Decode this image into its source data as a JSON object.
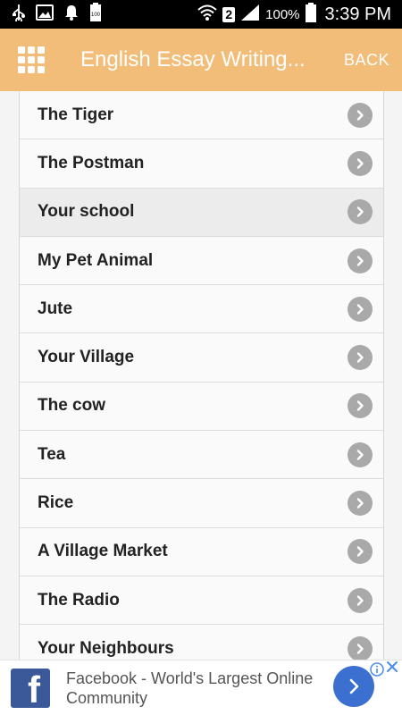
{
  "status_bar": {
    "sim_slot": "2",
    "battery_level": "100%",
    "battery_badge": "100",
    "time": "3:39 PM",
    "icons": [
      "usb-icon",
      "image-icon",
      "notification-bell-icon",
      "battery-full-icon",
      "wifi-icon",
      "signal-icon",
      "battery-icon"
    ]
  },
  "app_bar": {
    "menu_icon": "grid-menu-icon",
    "title": "English Essay Writing...",
    "back_label": "BACK",
    "color": "#f2bd78"
  },
  "list": {
    "items": [
      {
        "label": "The Tiger"
      },
      {
        "label": "The Postman"
      },
      {
        "label": "Your school",
        "selected": true
      },
      {
        "label": "My Pet Animal"
      },
      {
        "label": "Jute"
      },
      {
        "label": "Your Village"
      },
      {
        "label": "The cow"
      },
      {
        "label": "Tea"
      },
      {
        "label": "Rice"
      },
      {
        "label": "A Village Market"
      },
      {
        "label": "The Radio"
      },
      {
        "label": "Your Neighbours"
      }
    ],
    "chevron_icon": "chevron-right-circle-icon"
  },
  "ad": {
    "logo_icon": "facebook-logo-icon",
    "text": "Facebook - World's Largest Online Community",
    "cta_icon": "chevron-right-icon",
    "info_icon": "info-icon",
    "close_icon": "close-icon",
    "brand_color": "#3b5998"
  }
}
